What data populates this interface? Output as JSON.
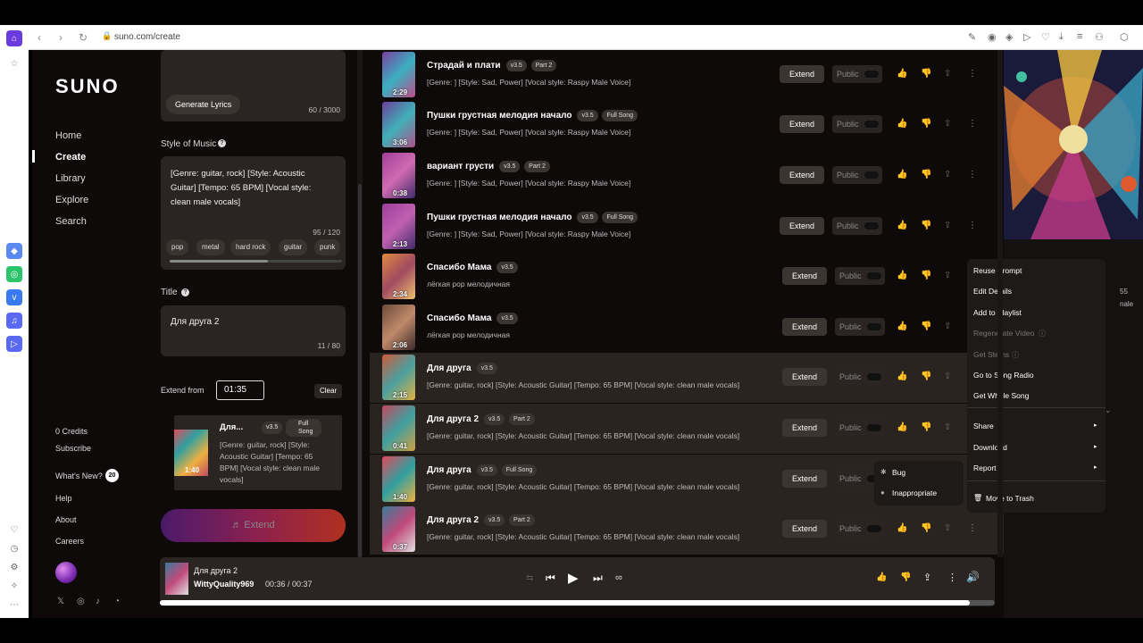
{
  "browser": {
    "url": "suno.com/create"
  },
  "nav": {
    "logo": "SUNO",
    "items": [
      "Home",
      "Create",
      "Library",
      "Explore",
      "Search"
    ],
    "credits": "0 Credits",
    "subscribe": "Subscribe",
    "whats_new": "What's New?",
    "whats_new_count": "20",
    "help": "Help",
    "about": "About",
    "careers": "Careers"
  },
  "create": {
    "generate_lyrics": "Generate Lyrics",
    "lyrics_count": "60 / 3000",
    "style_label": "Style of Music",
    "style_text": "[Genre: guitar, rock] [Style: Acoustic Guitar] [Tempo: 65 BPM] [Vocal style: clean male vocals]",
    "style_count": "95 / 120",
    "style_tags": [
      "pop",
      "metal",
      "hard rock",
      "guitar",
      "punk"
    ],
    "title_label": "Title",
    "title_value": "Для друга 2",
    "title_count": "11 / 80",
    "extend_from_label": "Extend from",
    "extend_from_value": "01:35",
    "clear": "Clear",
    "clip": {
      "title": "Для...",
      "version": "v3.5",
      "badge": "Full Song",
      "desc": "[Genre: guitar, rock] [Style: Acoustic Guitar] [Tempo: 65 BPM] [Vocal style: clean male vocals]",
      "duration": "1:40"
    },
    "extend_button": "Extend"
  },
  "songs": [
    {
      "title": "Страдай и плати",
      "version": "v3.5",
      "badge": "Part 2",
      "desc": "[Genre: ] [Style: Sad, Power] [Vocal style: Raspy Male Voice]",
      "duration": "2:29",
      "liked": true,
      "colors": [
        "#7a3fa0",
        "#3bb0c0",
        "#c04a8a"
      ]
    },
    {
      "title": "Пушки грустная мелодия начало",
      "version": "v3.5",
      "badge": "Full Song",
      "desc": "[Genre: ] [Style: Sad, Power] [Vocal style: Raspy Male Voice]",
      "duration": "3:06",
      "liked": false,
      "colors": [
        "#6a3f9a",
        "#40b0b8",
        "#b0508a"
      ]
    },
    {
      "title": "вариант грусти",
      "version": "v3.5",
      "badge": "Part 2",
      "desc": "[Genre: ] [Style: Sad, Power] [Vocal style: Raspy Male Voice]",
      "duration": "0:38",
      "liked": false,
      "colors": [
        "#a03f9a",
        "#d06ab0",
        "#402a6a"
      ]
    },
    {
      "title": "Пушки грустная мелодия начало",
      "version": "v3.5",
      "badge": "Full Song",
      "desc": "[Genre: ] [Style: Sad, Power] [Vocal style: Raspy Male Voice]",
      "duration": "2:13",
      "liked": false,
      "colors": [
        "#9a3f9a",
        "#c060b0",
        "#402a6a"
      ]
    },
    {
      "title": "Спасибо Мама",
      "version": "v3.5",
      "badge": "",
      "desc": "лёгкая pop мелодичная",
      "duration": "2:34",
      "liked": false,
      "colors": [
        "#e08a40",
        "#a04a60",
        "#f0c070"
      ]
    },
    {
      "title": "Спасибо Мама",
      "version": "v3.5",
      "badge": "",
      "desc": "лёгкая pop мелодичная",
      "duration": "2:06",
      "liked": false,
      "colors": [
        "#6a4a3a",
        "#c08a6a",
        "#3a2a2a"
      ]
    },
    {
      "title": "Для друга",
      "version": "v3.5",
      "badge": "",
      "desc": "[Genre: guitar, rock] [Style: Acoustic Guitar] [Tempo: 65 BPM] [Vocal style: clean male vocals]",
      "duration": "2:15",
      "liked": true,
      "colors": [
        "#d05a3a",
        "#4aa0a0",
        "#e0b040"
      ]
    },
    {
      "title": "Для друга 2",
      "version": "v3.5",
      "badge": "Part 2",
      "desc": "[Genre: guitar, rock] [Style: Acoustic Guitar] [Tempo: 65 BPM] [Vocal style: clean male vocals]",
      "duration": "0:41",
      "liked": true,
      "colors": [
        "#c04a60",
        "#40a0a0",
        "#d0a040"
      ]
    },
    {
      "title": "Для друга",
      "version": "v3.5",
      "badge": "Full Song",
      "desc": "[Genre: guitar, rock] [Style: Acoustic Guitar] [Tempo: 65 BPM] [Vocal style: clean male vocals]",
      "duration": "1:40",
      "liked": false,
      "colors": [
        "#e04a5a",
        "#30a0a0",
        "#f0b040"
      ]
    },
    {
      "title": "Для друга 2",
      "version": "v3.5",
      "badge": "Part 2",
      "desc": "[Genre: guitar, rock] [Style: Acoustic Guitar] [Tempo: 65 BPM] [Vocal style: clean male vocals]",
      "duration": "0:37",
      "liked": false,
      "colors": [
        "#3a7a9a",
        "#c04a7a",
        "#e0e0e0"
      ]
    }
  ],
  "row_labels": {
    "extend": "Extend",
    "public": "Public"
  },
  "right_panel": {
    "snip1": "55",
    "snip2": "nale"
  },
  "context_menu": {
    "items": [
      "Reuse Prompt",
      "Edit Details",
      "Add to Playlist",
      "Regenerate Video",
      "Get Stems",
      "Go to Song Radio",
      "Get Whole Song",
      "Share",
      "Download",
      "Report",
      "Move to Trash"
    ]
  },
  "report_submenu": [
    "Bug",
    "Inappropriate"
  ],
  "player": {
    "title": "Для друга 2",
    "artist": "WittyQuality969",
    "time": "00:36 / 00:37",
    "progress": 0.97
  }
}
